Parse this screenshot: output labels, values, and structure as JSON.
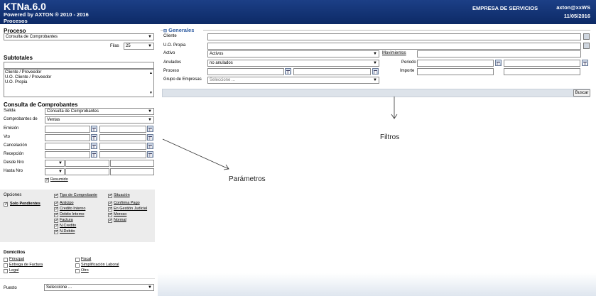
{
  "header": {
    "app_title": "KTNa.6.0",
    "powered": "Powered by AXTON ® 2010 - 2016",
    "section": "Procesos",
    "company": "EMPRESA DE SERVICIOS",
    "user": "axton@xxWS",
    "date": "11/05/2016"
  },
  "proceso": {
    "title": "Proceso",
    "value": "Consulta de Comprobantes",
    "filas_label": "Filas",
    "filas_value": "25"
  },
  "subtotales": {
    "title": "Subtotales",
    "items": [
      "Cliente / Proveedor",
      "U.O. Cliente / Proveedor",
      "U.O. Propia"
    ]
  },
  "consulta": {
    "title": "Consulta de Comprobantes",
    "salida_label": "Salida",
    "salida_value": "Consulta de Comprobantes",
    "comprobantes_label": "Comprobantes de",
    "comprobantes_value": "Ventas",
    "emision": "Emisión",
    "vto": "Vto",
    "cancelacion": "Cancelación",
    "recepcion": "Recepción",
    "desde_nro": "Desde Nro",
    "hasta_nro": "Hasta Nro",
    "resumido": "Resumido"
  },
  "opciones": {
    "title": "Opciones",
    "solo_pendientes": "Solo Pendientes",
    "tipo_header": "Tipo de Comprobante",
    "tipos": [
      "Anticipo",
      "Credito Interno",
      "Debito Interno",
      "Factura",
      "N.Credito",
      "N.Debito"
    ],
    "situacion_header": "Situación",
    "situaciones": [
      "Confirma Pago",
      "En Gestión Judicial",
      "Moroso",
      "Normal"
    ]
  },
  "domicilios": {
    "title": "Domicilios",
    "col1": [
      "Principal",
      "Entrega de Factura",
      "Legal"
    ],
    "col2": [
      "Fiscal",
      "Simplificación Laboral",
      "Otro"
    ]
  },
  "puesto": {
    "label": "Puesto",
    "value": "Seleccione ..."
  },
  "generales": {
    "title": "Generales",
    "cliente": "Cliente",
    "uo_propia": "U.O. Propia",
    "activo_label": "Activo",
    "activo_value": "Activos",
    "anulados_label": "Anulados",
    "anulados_value": "no anulados",
    "proceso_label": "Proceso",
    "grupo_label": "Grupo de Empresas",
    "grupo_value": "Seleccione ...",
    "movimientos": "Movimientos",
    "periodo": "Periodo",
    "importe": "Importe",
    "buscar": "Buscar"
  },
  "annotations": {
    "filtros": "Filtros",
    "parametros": "Parámetros"
  }
}
